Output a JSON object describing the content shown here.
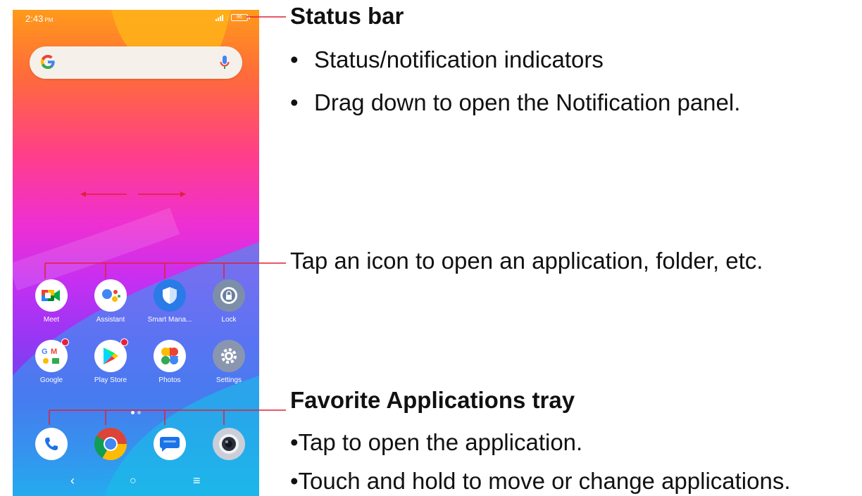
{
  "phone": {
    "status_bar": {
      "time": "2:43",
      "time_suffix": "PM",
      "battery_level": "86"
    },
    "search": {
      "logo": "G"
    },
    "apps": [
      {
        "label": "Meet",
        "icon": "meet-icon"
      },
      {
        "label": "Assistant",
        "icon": "assistant-icon"
      },
      {
        "label": "Smart Mana...",
        "icon": "smart-manager-icon"
      },
      {
        "label": "Lock",
        "icon": "lock-icon"
      },
      {
        "label": "Google",
        "icon": "google-folder-icon",
        "badge": true
      },
      {
        "label": "Play Store",
        "icon": "play-store-icon",
        "badge": true
      },
      {
        "label": "Photos",
        "icon": "photos-icon"
      },
      {
        "label": "Settings",
        "icon": "settings-icon"
      }
    ],
    "tray": [
      {
        "icon": "phone-icon"
      },
      {
        "icon": "chrome-icon"
      },
      {
        "icon": "messages-icon"
      },
      {
        "icon": "camera-icon"
      }
    ],
    "nav": {
      "back": "‹",
      "home": "○",
      "menu": "≡"
    }
  },
  "annotations": {
    "status_bar_title": "Status bar",
    "status_bar_bullets": [
      "Status/notification indicators",
      "Drag down to open the Notification panel."
    ],
    "icon_tap_note": "Tap an icon to open an application, folder, etc.",
    "tray_title": "Favorite Applications tray",
    "tray_bullets": [
      "•Tap to open the application.",
      "•Touch and hold to move or change applications."
    ],
    "bullet_char": "•"
  },
  "colors": {
    "annotation_line": "#e0203a",
    "text": "#111111"
  }
}
